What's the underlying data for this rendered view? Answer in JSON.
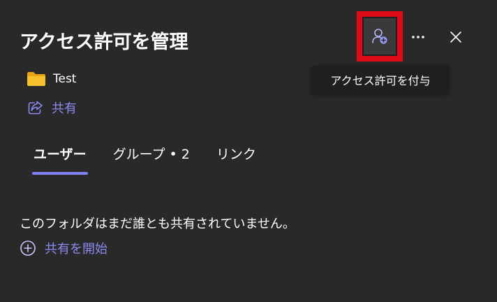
{
  "panel": {
    "title": "アクセス許可を管理",
    "grant_tooltip": "アクセス許可を付与"
  },
  "item": {
    "icon": "folder-icon",
    "name": "Test"
  },
  "share": {
    "icon": "share-icon",
    "label": "共有"
  },
  "tabs": [
    {
      "label": "ユーザー",
      "active": true
    },
    {
      "label": "グループ • 2",
      "active": false
    },
    {
      "label": "リンク",
      "active": false
    }
  ],
  "empty_state": {
    "message": "このフォルダはまだ誰とも共有されていません。",
    "action_label": "共有を開始",
    "action_icon": "plus-circle-icon"
  },
  "colors": {
    "background": "#292929",
    "accent": "#7f85f5",
    "link": "#8b8cf0",
    "highlight_border": "#e00a14",
    "folder": "#f5c02b"
  }
}
